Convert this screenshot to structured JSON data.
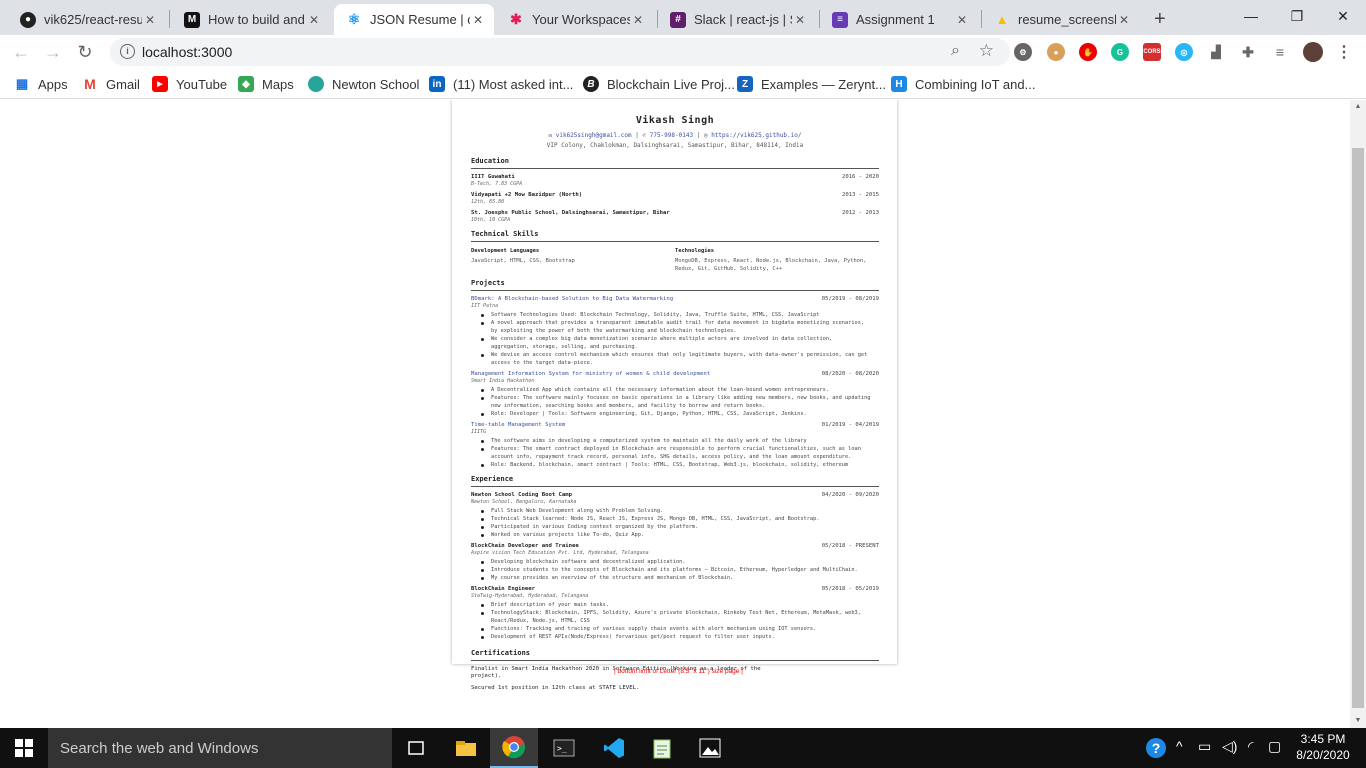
{
  "window": {
    "minimize": "—",
    "maximize": "❐",
    "close": "✕"
  },
  "tabs": [
    {
      "label": "vik625/react-resum",
      "icon": "github-icon"
    },
    {
      "label": "How to build and",
      "icon": "medium-icon"
    },
    {
      "label": "JSON Resume | co",
      "icon": "react-icon",
      "active": true
    },
    {
      "label": "Your Workspaces",
      "icon": "slack-icon"
    },
    {
      "label": "Slack | react-js | Sk",
      "icon": "slack-icon"
    },
    {
      "label": "Assignment 1",
      "icon": "forms-icon"
    },
    {
      "label": "resume_screensho",
      "icon": "drive-icon"
    }
  ],
  "new_tab": "+",
  "address": {
    "url": "localhost:3000"
  },
  "bookmarks": [
    {
      "label": "Apps"
    },
    {
      "label": "Gmail"
    },
    {
      "label": "YouTube"
    },
    {
      "label": "Maps"
    },
    {
      "label": "Newton School"
    },
    {
      "label": "(11) Most asked int..."
    },
    {
      "label": "Blockchain Live Proj..."
    },
    {
      "label": "Examples — Zerynt..."
    },
    {
      "label": "Combining IoT and..."
    }
  ],
  "resume": {
    "name": "Vikash Singh",
    "email": "vik625singh@gmail.com",
    "phone": "775-998-0143",
    "website": "https://vik625.github.io/",
    "address": "VIP Colony, Chaklokman, Dalsinghsarai, Samastipur, Bihar, 848114, India",
    "sections": {
      "education": "Education",
      "skills": "Technical Skills",
      "projects": "Projects",
      "experience": "Experience",
      "certifications": "Certifications"
    },
    "education": [
      {
        "school": "IIIT Guwahati",
        "detail": "B-Tech, 7.83 CGPA",
        "dates": "2016 - 2020"
      },
      {
        "school": "Vidyapati +2 Mow Bazidpur (North)",
        "detail": "12th, 85.80",
        "dates": "2013 - 2015"
      },
      {
        "school": "St. Joesphs Public School, Dalsinghsarai, Samastipur, Bihar",
        "detail": "10th, 10 CGPA",
        "dates": "2012 - 2013"
      }
    ],
    "skills": {
      "lang_title": "Development Languages",
      "lang_values": "JavaScript, HTML, CSS, Bootstrap",
      "tech_title": "Technologies",
      "tech_values": "MongoDB, Express, React, Node.js, Blockchain, Java, Python, Redux, Git, GitHub, Solidity, C++"
    },
    "projects": [
      {
        "title": "BDmark: A Blockchain-based Solution to Big Data Watermarking",
        "org": "IIT Patna",
        "dates": "05/2019 - 08/2019",
        "bullets": [
          "Software Technologies Used: Blockchain Technology, Solidity, Java, Truffle Suite, HTML, CSS, JavaScript",
          "A novel approach that provides a transparent immutable audit trail for data movement in bigdata monetizing scenarios, by exploiting the power of both the watermarking and blockchain technologies.",
          "We consider a complex big data monetization scenario where multiple actors are involved in data collection, aggregation, storage, selling, and purchasing.",
          "We devise an access control mechanism which ensures that only legitimate buyers, with data-owner's permission, can get access to the target data-piece."
        ]
      },
      {
        "title": "Management Information System for ministry of women & child development",
        "org": "Smart India Hackathon",
        "dates": "08/2020 - 08/2020",
        "bullets": [
          "A Decentralized App which contains all the necessary information about the loan-bound women entrepreneurs.",
          "Features: The software mainly focuses on basic operations in a library like adding new members, new books, and updating new information, searching books and members, and facility to borrow and return books.",
          "Role: Developer | Tools: Software engineering, Git, Django, Python, HTML, CSS, JavaScript, Jenkins."
        ]
      },
      {
        "title": "Time-table Management System",
        "org": "IIITG",
        "dates": "01/2019 - 04/2019",
        "bullets": [
          "The software aims in developing a computerized system to maintain all the daily work of the library",
          "Features: The smart contract deployed in Blockchain are responsible to perform crucial functionalities, such as loan account info, repayment track record, personal info, SHG details, access policy, and the loan amount expenditure.",
          "Role: Backend, blockchain, smart contract | Tools: HTML, CSS, Bootstrap, Web3.js, blockchain, solidity, ethereum"
        ]
      }
    ],
    "experience": [
      {
        "title": "Newton School Coding Boot Camp",
        "org": "Newton School, Bengaluru, Karnataka",
        "dates": "04/2020 - 09/2020",
        "bullets": [
          "Full Stack Web Development along with Problem Solving.",
          "Technical Stack learned: Node JS, React JS, Express JS, Mongo DB, HTML, CSS, JavaScript, and Bootstrap.",
          "Participated in various Coding contest organized by the platform.",
          "Worked on various projects like To-do, Quiz App."
        ]
      },
      {
        "title": "BlockChain Developer and Trainee",
        "org": "Aspire vision Tech Education Pvt. Ltd, Hyderabad, Telangana",
        "dates": "05/2018 - PRESENT",
        "bullets": [
          "Developing blockchain software and decentralized application.",
          "Introduce students to the concepts of Blockchain and its platforms – Bitcoin, Ethereum, Hyperledger and MultiChain.",
          "My course provides an overview of the structure and mechanism of Blockchain."
        ]
      },
      {
        "title": "BlockChain Engineer",
        "org": "StaTwig-Hyderabad, Hyderabad, Telangana",
        "dates": "05/2018 - 05/2019",
        "bullets": [
          "Brief description of your main tasks.",
          "TechnologyStack: Blockchain, IPFS, Solidity, Azure's private blockchain, Rinkeby Test Net, Ethereum, MetaMask, web3, React/Redux, Node.js, HTML, CSS",
          "Functions: Tracking and tracing of various supply chain events with alert mechanism using IOT sensors.",
          "Development of REST APIs(Node/Express) forvarious get/post request to filter user inputs."
        ]
      }
    ],
    "certifications": [
      "Finalist in Smart India Hackathon 2020 in Software Edition (Working as a leader of the project).",
      "Secured 1st position in 12th class at STATE LEVEL."
    ],
    "page_limit_note": "| bottom limit of Letter (8.5\" x 11\") size page |"
  },
  "taskbar": {
    "search_placeholder": "Search the web and Windows",
    "time": "3:45 PM",
    "date": "8/20/2020"
  },
  "colors": {
    "link": "#3a4fa0",
    "limit_note": "#e00000",
    "taskbar": "#101010"
  }
}
